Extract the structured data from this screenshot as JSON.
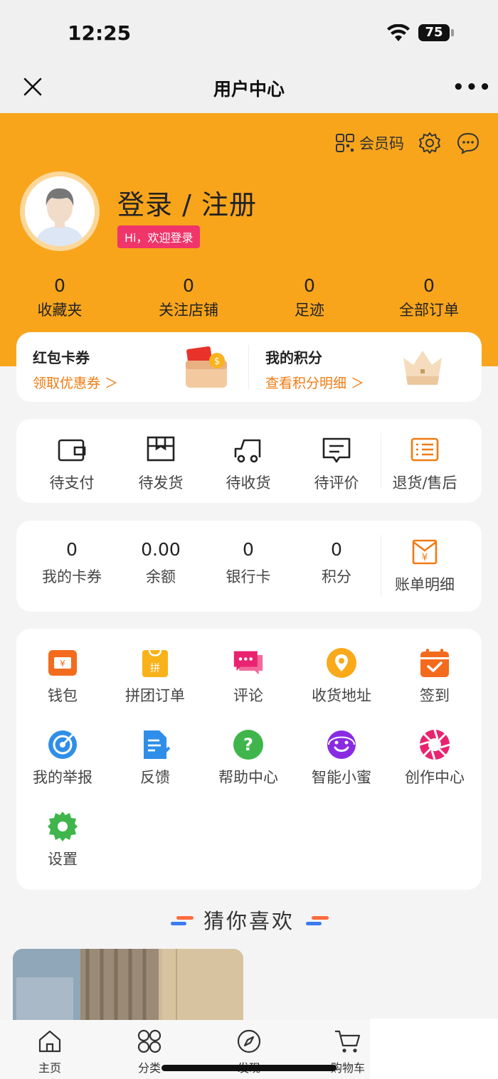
{
  "status_bar": {
    "time": "12:25",
    "battery": "75"
  },
  "nav": {
    "title": "用户中心",
    "more": "•••"
  },
  "header": {
    "member_code": "会员码",
    "login_title": "登录 / 注册",
    "welcome": "Hi，欢迎登录",
    "stats": [
      {
        "value": "0",
        "label": "收藏夹"
      },
      {
        "value": "0",
        "label": "关注店铺"
      },
      {
        "value": "0",
        "label": "足迹"
      },
      {
        "value": "0",
        "label": "全部订单"
      }
    ]
  },
  "promo": {
    "left": {
      "title": "红包卡券",
      "link": "领取优惠券 ＞"
    },
    "right": {
      "title": "我的积分",
      "link": "查看积分明细 ＞"
    }
  },
  "orders": [
    {
      "label": "待支付",
      "icon": "wallet-icon"
    },
    {
      "label": "待发货",
      "icon": "box-icon"
    },
    {
      "label": "待收货",
      "icon": "truck-icon"
    },
    {
      "label": "待评价",
      "icon": "comment-icon"
    },
    {
      "label": "退货/售后",
      "icon": "return-list-icon"
    }
  ],
  "wallet": [
    {
      "value": "0",
      "label": "我的卡券"
    },
    {
      "value": "0.00",
      "label": "余额"
    },
    {
      "value": "0",
      "label": "银行卡"
    },
    {
      "value": "0",
      "label": "积分"
    },
    {
      "label": "账单明细",
      "icon": "bill-icon"
    }
  ],
  "services": [
    {
      "label": "钱包",
      "icon": "wallet-ticket-icon",
      "color": "#f36b1c"
    },
    {
      "label": "拼团订单",
      "icon": "group-buy-icon",
      "color": "#f9b21a"
    },
    {
      "label": "评论",
      "icon": "chat-bubbles-icon",
      "color": "#e9236f"
    },
    {
      "label": "收货地址",
      "icon": "location-pin-icon",
      "color": "#f9a91a"
    },
    {
      "label": "签到",
      "icon": "calendar-check-icon",
      "color": "#f36b1c"
    },
    {
      "label": "我的举报",
      "icon": "target-icon",
      "color": "#2f8ee8"
    },
    {
      "label": "反馈",
      "icon": "document-edit-icon",
      "color": "#2f8ee8"
    },
    {
      "label": "帮助中心",
      "icon": "question-icon",
      "color": "#3fb54b"
    },
    {
      "label": "智能小蜜",
      "icon": "assistant-face-icon",
      "color": "#8a2be2"
    },
    {
      "label": "创作中心",
      "icon": "aperture-icon",
      "color": "#e9236f"
    },
    {
      "label": "设置",
      "icon": "gear-icon",
      "color": "#3fb54b"
    }
  ],
  "guess": {
    "title": "猜你喜欢"
  },
  "tabs": [
    {
      "label": "主页",
      "icon": "home-icon"
    },
    {
      "label": "分类",
      "icon": "category-icon"
    },
    {
      "label": "发现",
      "icon": "compass-icon"
    },
    {
      "label": "购物车",
      "icon": "cart-icon"
    }
  ]
}
